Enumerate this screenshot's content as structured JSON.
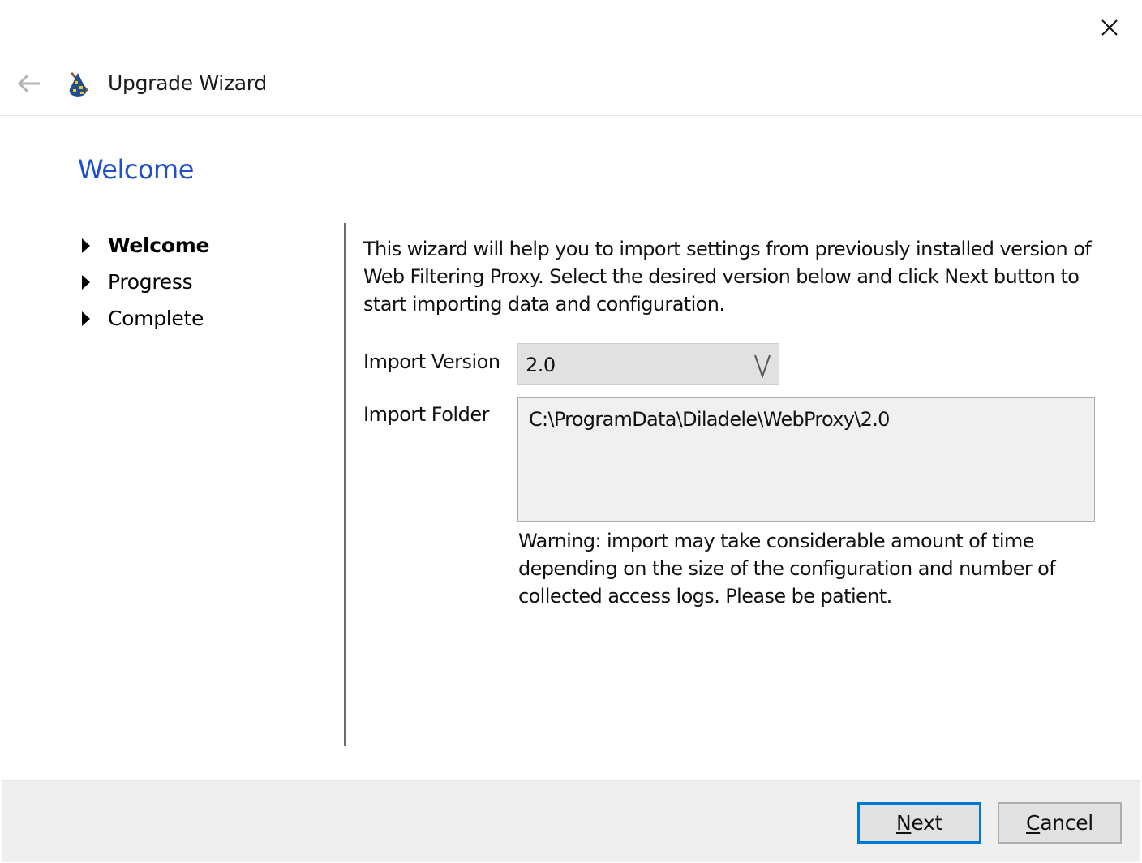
{
  "window": {
    "close_icon": "close-x-icon"
  },
  "header": {
    "back_icon": "arrow-left-icon",
    "app_icon": "wizard-hat-icon",
    "title": "Upgrade Wizard"
  },
  "page": {
    "title": "Welcome"
  },
  "steps": [
    {
      "label": "Welcome",
      "active": true
    },
    {
      "label": "Progress",
      "active": false
    },
    {
      "label": "Complete",
      "active": false
    }
  ],
  "content": {
    "intro": "This wizard will help you to import settings from previously installed version of Web Filtering Proxy. Select the desired version below and click Next button to start importing data and configuration.",
    "import_version_label": "Import Version",
    "import_version_value": "2.0",
    "import_folder_label": "Import Folder",
    "import_folder_value": "C:\\ProgramData\\Diladele\\WebProxy\\2.0",
    "warning": "Warning: import may take considerable amount of time depending on the size of the configuration and number of collected access logs. Please be patient."
  },
  "footer": {
    "next": {
      "accel": "N",
      "rest": "ext"
    },
    "cancel": {
      "accel": "C",
      "rest": "ancel"
    }
  },
  "colors": {
    "accent": "#0078d7",
    "title_blue": "#1f4fcc",
    "footer_bg": "#efefef"
  }
}
